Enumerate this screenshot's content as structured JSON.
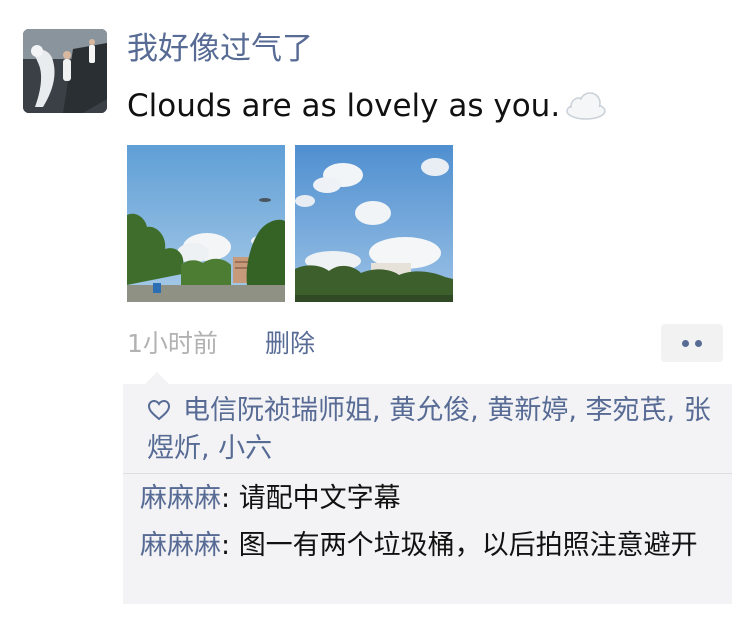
{
  "post": {
    "username": "我好像过气了",
    "text": "Clouds are as lovely as you.",
    "text_emoji": "cloud-emoji",
    "photos": [
      {
        "name": "photo-1",
        "description_icon": "sky-trees-photo"
      },
      {
        "name": "photo-2",
        "description_icon": "sky-clouds-photo"
      }
    ],
    "time": "1小时前",
    "delete_label": "删除",
    "more_icon": "more-dots-icon"
  },
  "likes": {
    "icon": "heart-icon",
    "names": [
      "电信阮祯瑞师姐",
      "黄允俊",
      "黄新婷",
      "李宛芪",
      "张煜炘",
      "小六"
    ]
  },
  "comments": [
    {
      "author": "麻麻麻",
      "separator": ": ",
      "text": "请配中文字幕"
    },
    {
      "author": "麻麻麻",
      "separator": ": ",
      "text": "图一有两个垃圾桶，以后拍照注意避开"
    }
  ],
  "colors": {
    "link": "#576b95",
    "text": "#111111",
    "muted": "#b2b2b2",
    "comment_bg": "#f3f3f5"
  }
}
